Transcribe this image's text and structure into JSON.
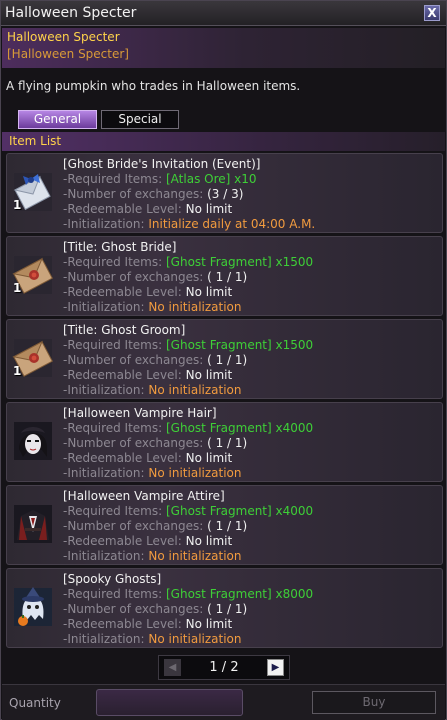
{
  "window": {
    "title": "Halloween Specter",
    "close_label": "X"
  },
  "npc": {
    "name": "Halloween Specter",
    "subtitle": "[Halloween Specter]",
    "description": "A flying pumpkin who trades in Halloween items."
  },
  "tabs": [
    {
      "label": "General",
      "active": true
    },
    {
      "label": "Special",
      "active": false
    }
  ],
  "item_list_label": "Item List",
  "field_labels": {
    "required": "-Required Items:",
    "exchanges": "-Number of exchanges:",
    "redeemable": "-Redeemable Level:",
    "init": "-Initialization:"
  },
  "items": [
    {
      "name": "[Ghost Bride's Invitation (Event)]",
      "required": "[Atlas Ore] x10",
      "exchanges": "(3 / 3)",
      "redeemable": "No limit",
      "init": "Initialize daily at 04:00 A.M.",
      "qty": "1",
      "icon": "invitation-icon"
    },
    {
      "name": "[Title: Ghost Bride]",
      "required": "[Ghost Fragment] x1500",
      "exchanges": "( 1 / 1)",
      "redeemable": "No limit",
      "init": "No initialization",
      "qty": "1",
      "icon": "letter-icon"
    },
    {
      "name": "[Title: Ghost Groom]",
      "required": "[Ghost Fragment] x1500",
      "exchanges": "( 1 / 1)",
      "redeemable": "No limit",
      "init": "No initialization",
      "qty": "1",
      "icon": "letter-icon"
    },
    {
      "name": "[Halloween Vampire Hair]",
      "required": "[Ghost Fragment] x4000",
      "exchanges": "( 1 / 1)",
      "redeemable": "No limit",
      "init": "No initialization",
      "qty": "",
      "icon": "vampire-hair-icon"
    },
    {
      "name": "[Halloween Vampire Attire]",
      "required": "[Ghost Fragment] x4000",
      "exchanges": "( 1 / 1)",
      "redeemable": "No limit",
      "init": "No initialization",
      "qty": "",
      "icon": "vampire-attire-icon"
    },
    {
      "name": "[Spooky Ghosts]",
      "required": "[Ghost Fragment] x8000",
      "exchanges": "( 1 / 1)",
      "redeemable": "No limit",
      "init": "No initialization",
      "qty": "",
      "icon": "ghost-icon"
    }
  ],
  "pagination": {
    "current": "1",
    "total": "2",
    "text": "1 / 2"
  },
  "footer": {
    "quantity_label": "Quantity",
    "quantity_value": "",
    "buy_label": "Buy"
  },
  "colors": {
    "accent_gold": "#ffd34a",
    "green": "#3ecf37",
    "orange": "#f19b3f",
    "tab_active": "#9a66cc"
  }
}
